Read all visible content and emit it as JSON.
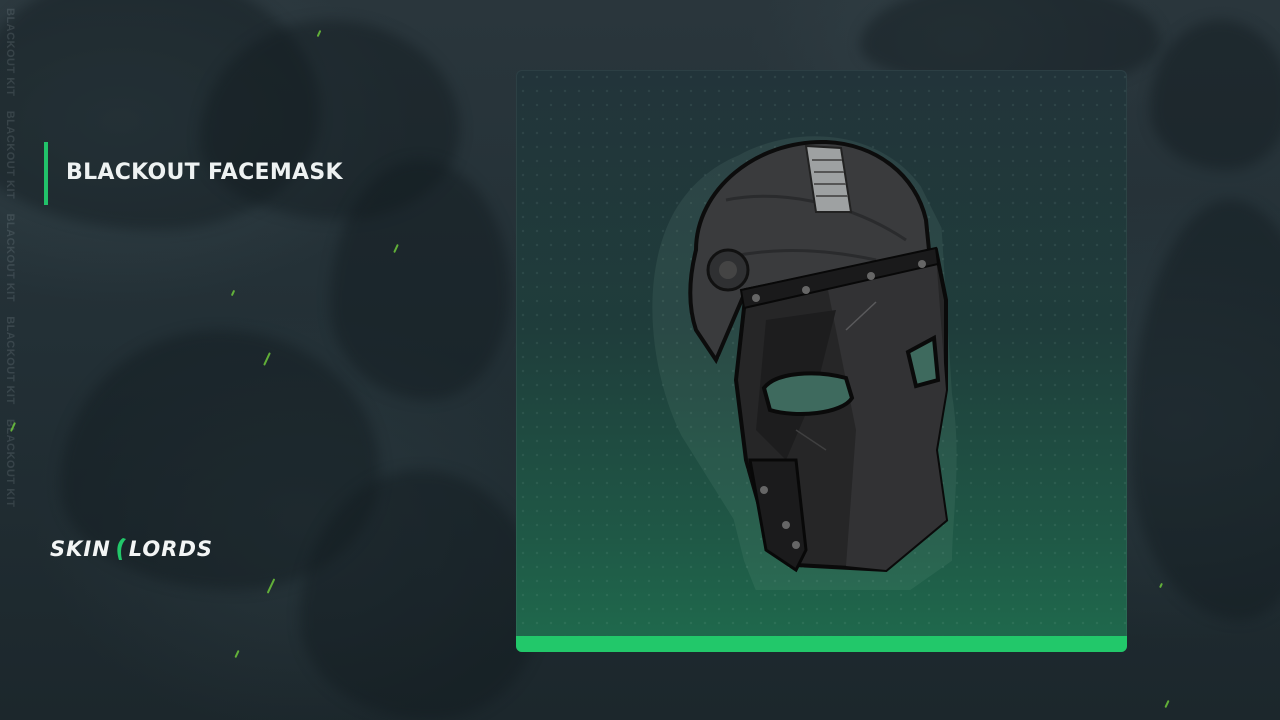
{
  "item": {
    "name": "BLACKOUT FACEMASK",
    "skin_kit_label": "BLACKOUT KIT"
  },
  "brand": {
    "left": "SKIN",
    "right": "LORDS"
  },
  "colors": {
    "accent": "#22c86a",
    "background": "#1f2b31",
    "title": "#eef2f2"
  },
  "icons": {
    "item_image": "blackout-facemask",
    "brand_mark": "skinlords-logo-mark"
  }
}
